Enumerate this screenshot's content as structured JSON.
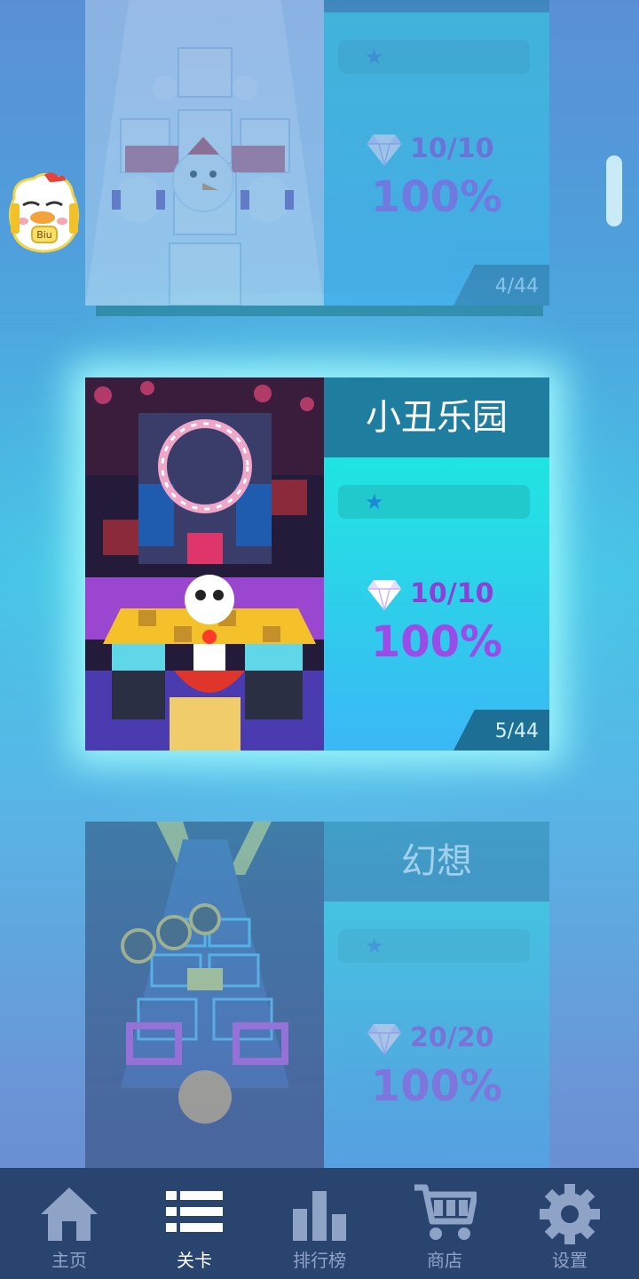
{
  "levels": [
    {
      "title": "",
      "stars": [
        "star-icon"
      ],
      "gems": "10/10",
      "percent": "100%",
      "number": "4/44",
      "state": "faded"
    },
    {
      "title": "小丑乐园",
      "stars": [
        "star-icon"
      ],
      "gems": "10/10",
      "percent": "100%",
      "number": "5/44",
      "state": "selected"
    },
    {
      "title": "幻想",
      "stars": [
        "star-icon"
      ],
      "gems": "20/20",
      "percent": "100%",
      "number": "",
      "state": "faded"
    }
  ],
  "nav": {
    "items": [
      {
        "label": "主页",
        "icon": "home-icon"
      },
      {
        "label": "关卡",
        "icon": "list-icon",
        "active": true
      },
      {
        "label": "排行榜",
        "icon": "bar-chart-icon"
      },
      {
        "label": "商店",
        "icon": "cart-icon"
      },
      {
        "label": "设置",
        "icon": "gear-icon"
      }
    ]
  },
  "avatar": {
    "icon": "chicken-avatar-icon",
    "badge": "Biu"
  },
  "colors": {
    "accent_teal": "#12f0dc",
    "title_bar": "#1f7ea0",
    "gem_purple": "#8d3fd6",
    "nav_bg": "#2a4470",
    "nav_inactive": "#8fa3c7"
  }
}
